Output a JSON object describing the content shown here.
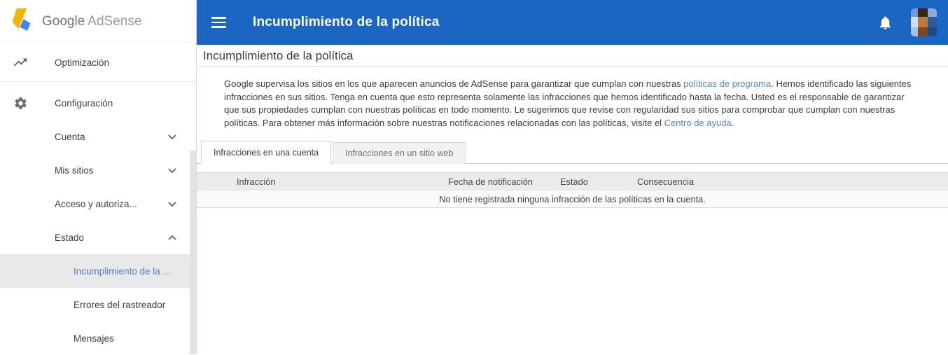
{
  "colors": {
    "appbar_blue": "#1b66c3",
    "sidebar_active_blue": "#4e7dc6",
    "link_blue": "#5b7fc7",
    "logo_yellow": "#f4b400",
    "logo_blue": "#4285f4",
    "active_row_gray": "#e9e9e9",
    "table_header_gray": "#ebebeb"
  },
  "sidebar": {
    "brand": {
      "google": "Google",
      "product": "AdSense",
      "logo_icon": "adsense-logo-icon"
    },
    "items": [
      {
        "label": "Optimización",
        "icon": "trending-up-icon"
      },
      {
        "label": "Configuración",
        "icon": "gear-icon"
      },
      {
        "label": "Cuenta",
        "chevron": "down"
      },
      {
        "label": "Mis sitios",
        "chevron": "down"
      },
      {
        "label": "Acceso y autoriza...",
        "chevron": "down"
      },
      {
        "label": "Estado",
        "chevron": "up"
      },
      {
        "label": "Incumplimiento de la ...",
        "active": true
      },
      {
        "label": "Errores del rastreador"
      },
      {
        "label": "Mensajes"
      }
    ]
  },
  "appbar": {
    "title": "Incumplimiento de la política",
    "menu_icon": "hamburger-menu-icon",
    "notifications_icon": "bell-icon",
    "avatar_icon": "user-avatar"
  },
  "main": {
    "heading": "Incumplimiento de la política",
    "intro": {
      "part1": "Google supervisa los sitios en los que aparecen anuncios de AdSense para garantizar que cumplan con nuestras ",
      "link1": "políticas de programa",
      "part2": ". Hemos identificado las siguientes infracciones en sus sitios. Tenga en cuenta que esto representa solamente las infracciones que hemos identificado hasta la fecha. Usted es el responsable de garantizar que sus propiedades cumplan con nuestras políticas en todo momento. Le sugerimos que revise con regularidad sus sitios para comprobar que cumplan con nuestras políticas. Para obtener más información sobre nuestras notificaciones relacionadas con las políticas, visite el ",
      "link2": "Centro de ayuda",
      "part3": "."
    },
    "tabs": [
      {
        "label": "Infracciones en una cuenta",
        "active": true
      },
      {
        "label": "Infracciones en un sitio web",
        "active": false
      }
    ],
    "table": {
      "columns": [
        "Infracción",
        "Fecha de notificación",
        "Estado",
        "Consecuencia"
      ],
      "empty_message": "No tiene registrada ninguna infracción de las políticas en la cuenta."
    }
  }
}
